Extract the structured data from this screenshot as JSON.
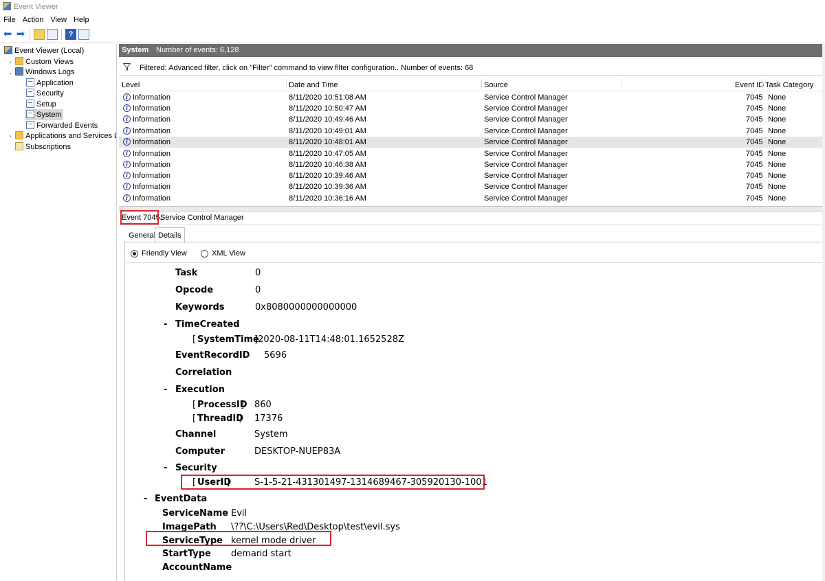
{
  "window": {
    "title": "Event Viewer"
  },
  "menu": [
    "File",
    "Action",
    "View",
    "Help"
  ],
  "toolbar": {
    "icons": [
      "back-arrow-icon",
      "forward-arrow-icon",
      "folder-up-icon",
      "properties-icon",
      "help-icon",
      "show-pane-icon"
    ]
  },
  "tree": {
    "root": "Event Viewer (Local)",
    "custom_views": "Custom Views",
    "windows_logs": "Windows Logs",
    "logs": [
      "Application",
      "Security",
      "Setup",
      "System",
      "Forwarded Events"
    ],
    "apps_services": "Applications and Services Lo",
    "subscriptions": "Subscriptions",
    "selected": "System"
  },
  "log_header": {
    "name": "System",
    "count_text": "Number of events: 6,128"
  },
  "filter_text": "Filtered: Advanced filter, click on \"Filter\" command to view filter configuration.. Number of events: 68",
  "columns": {
    "level": "Level",
    "date": "Date and Time",
    "source": "Source",
    "event_id": "Event ID",
    "task": "Task Category"
  },
  "events": [
    {
      "level": "Information",
      "date": "8/11/2020 10:51:08 AM",
      "source": "Service Control Manager",
      "id": "7045",
      "task": "None"
    },
    {
      "level": "Information",
      "date": "8/11/2020 10:50:47 AM",
      "source": "Service Control Manager",
      "id": "7045",
      "task": "None"
    },
    {
      "level": "Information",
      "date": "8/11/2020 10:49:46 AM",
      "source": "Service Control Manager",
      "id": "7045",
      "task": "None"
    },
    {
      "level": "Information",
      "date": "8/11/2020 10:49:01 AM",
      "source": "Service Control Manager",
      "id": "7045",
      "task": "None"
    },
    {
      "level": "Information",
      "date": "8/11/2020 10:48:01 AM",
      "source": "Service Control Manager",
      "id": "7045",
      "task": "None"
    },
    {
      "level": "Information",
      "date": "8/11/2020 10:47:05 AM",
      "source": "Service Control Manager",
      "id": "7045",
      "task": "None"
    },
    {
      "level": "Information",
      "date": "8/11/2020 10:46:38 AM",
      "source": "Service Control Manager",
      "id": "7045",
      "task": "None"
    },
    {
      "level": "Information",
      "date": "8/11/2020 10:39:46 AM",
      "source": "Service Control Manager",
      "id": "7045",
      "task": "None"
    },
    {
      "level": "Information",
      "date": "8/11/2020 10:39:36 AM",
      "source": "Service Control Manager",
      "id": "7045",
      "task": "None"
    },
    {
      "level": "Information",
      "date": "8/11/2020 10:36:16 AM",
      "source": "Service Control Manager",
      "id": "7045",
      "task": "None"
    }
  ],
  "selected_event": {
    "title": "Event 7045,",
    "source": "Service Control Manager"
  },
  "tabs": [
    "General",
    "Details"
  ],
  "view_options": {
    "friendly": "Friendly View",
    "xml": "XML View",
    "selected": "Friendly View"
  },
  "details": {
    "task_k": "Task",
    "task_v": "0",
    "opcode_k": "Opcode",
    "opcode_v": "0",
    "keywords_k": "Keywords",
    "keywords_v": "0x8080000000000000",
    "timecreated_k": "TimeCreated",
    "systemtime_k": "SystemTime",
    "systemtime_v": "2020-08-11T14:48:01.1652528Z",
    "recordid_k": "EventRecordID",
    "recordid_v": "5696",
    "correlation_k": "Correlation",
    "execution_k": "Execution",
    "processid_k": "ProcessID",
    "processid_v": "860",
    "threadid_k": "ThreadID",
    "threadid_v": "17376",
    "channel_k": "Channel",
    "channel_v": "System",
    "computer_k": "Computer",
    "computer_v": "DESKTOP-NUEP83A",
    "security_k": "Security",
    "userid_k": "UserID",
    "userid_v": "S-1-5-21-431301497-1314689467-305920130-1001",
    "eventdata_k": "EventData",
    "servicename_k": "ServiceName",
    "servicename_v": "Evil",
    "imagepath_k": "ImagePath",
    "imagepath_v": "\\??\\C:\\Users\\Red\\Desktop\\test\\evil.sys",
    "servicetype_k": "ServiceType",
    "servicetype_v": "kernel mode driver",
    "starttype_k": "StartType",
    "starttype_v": "demand start",
    "accountname_k": "AccountName"
  },
  "colors": {
    "header_bg": "#6e6e6e",
    "highlight": "#d9262c",
    "selection": "#e5e5e5"
  }
}
